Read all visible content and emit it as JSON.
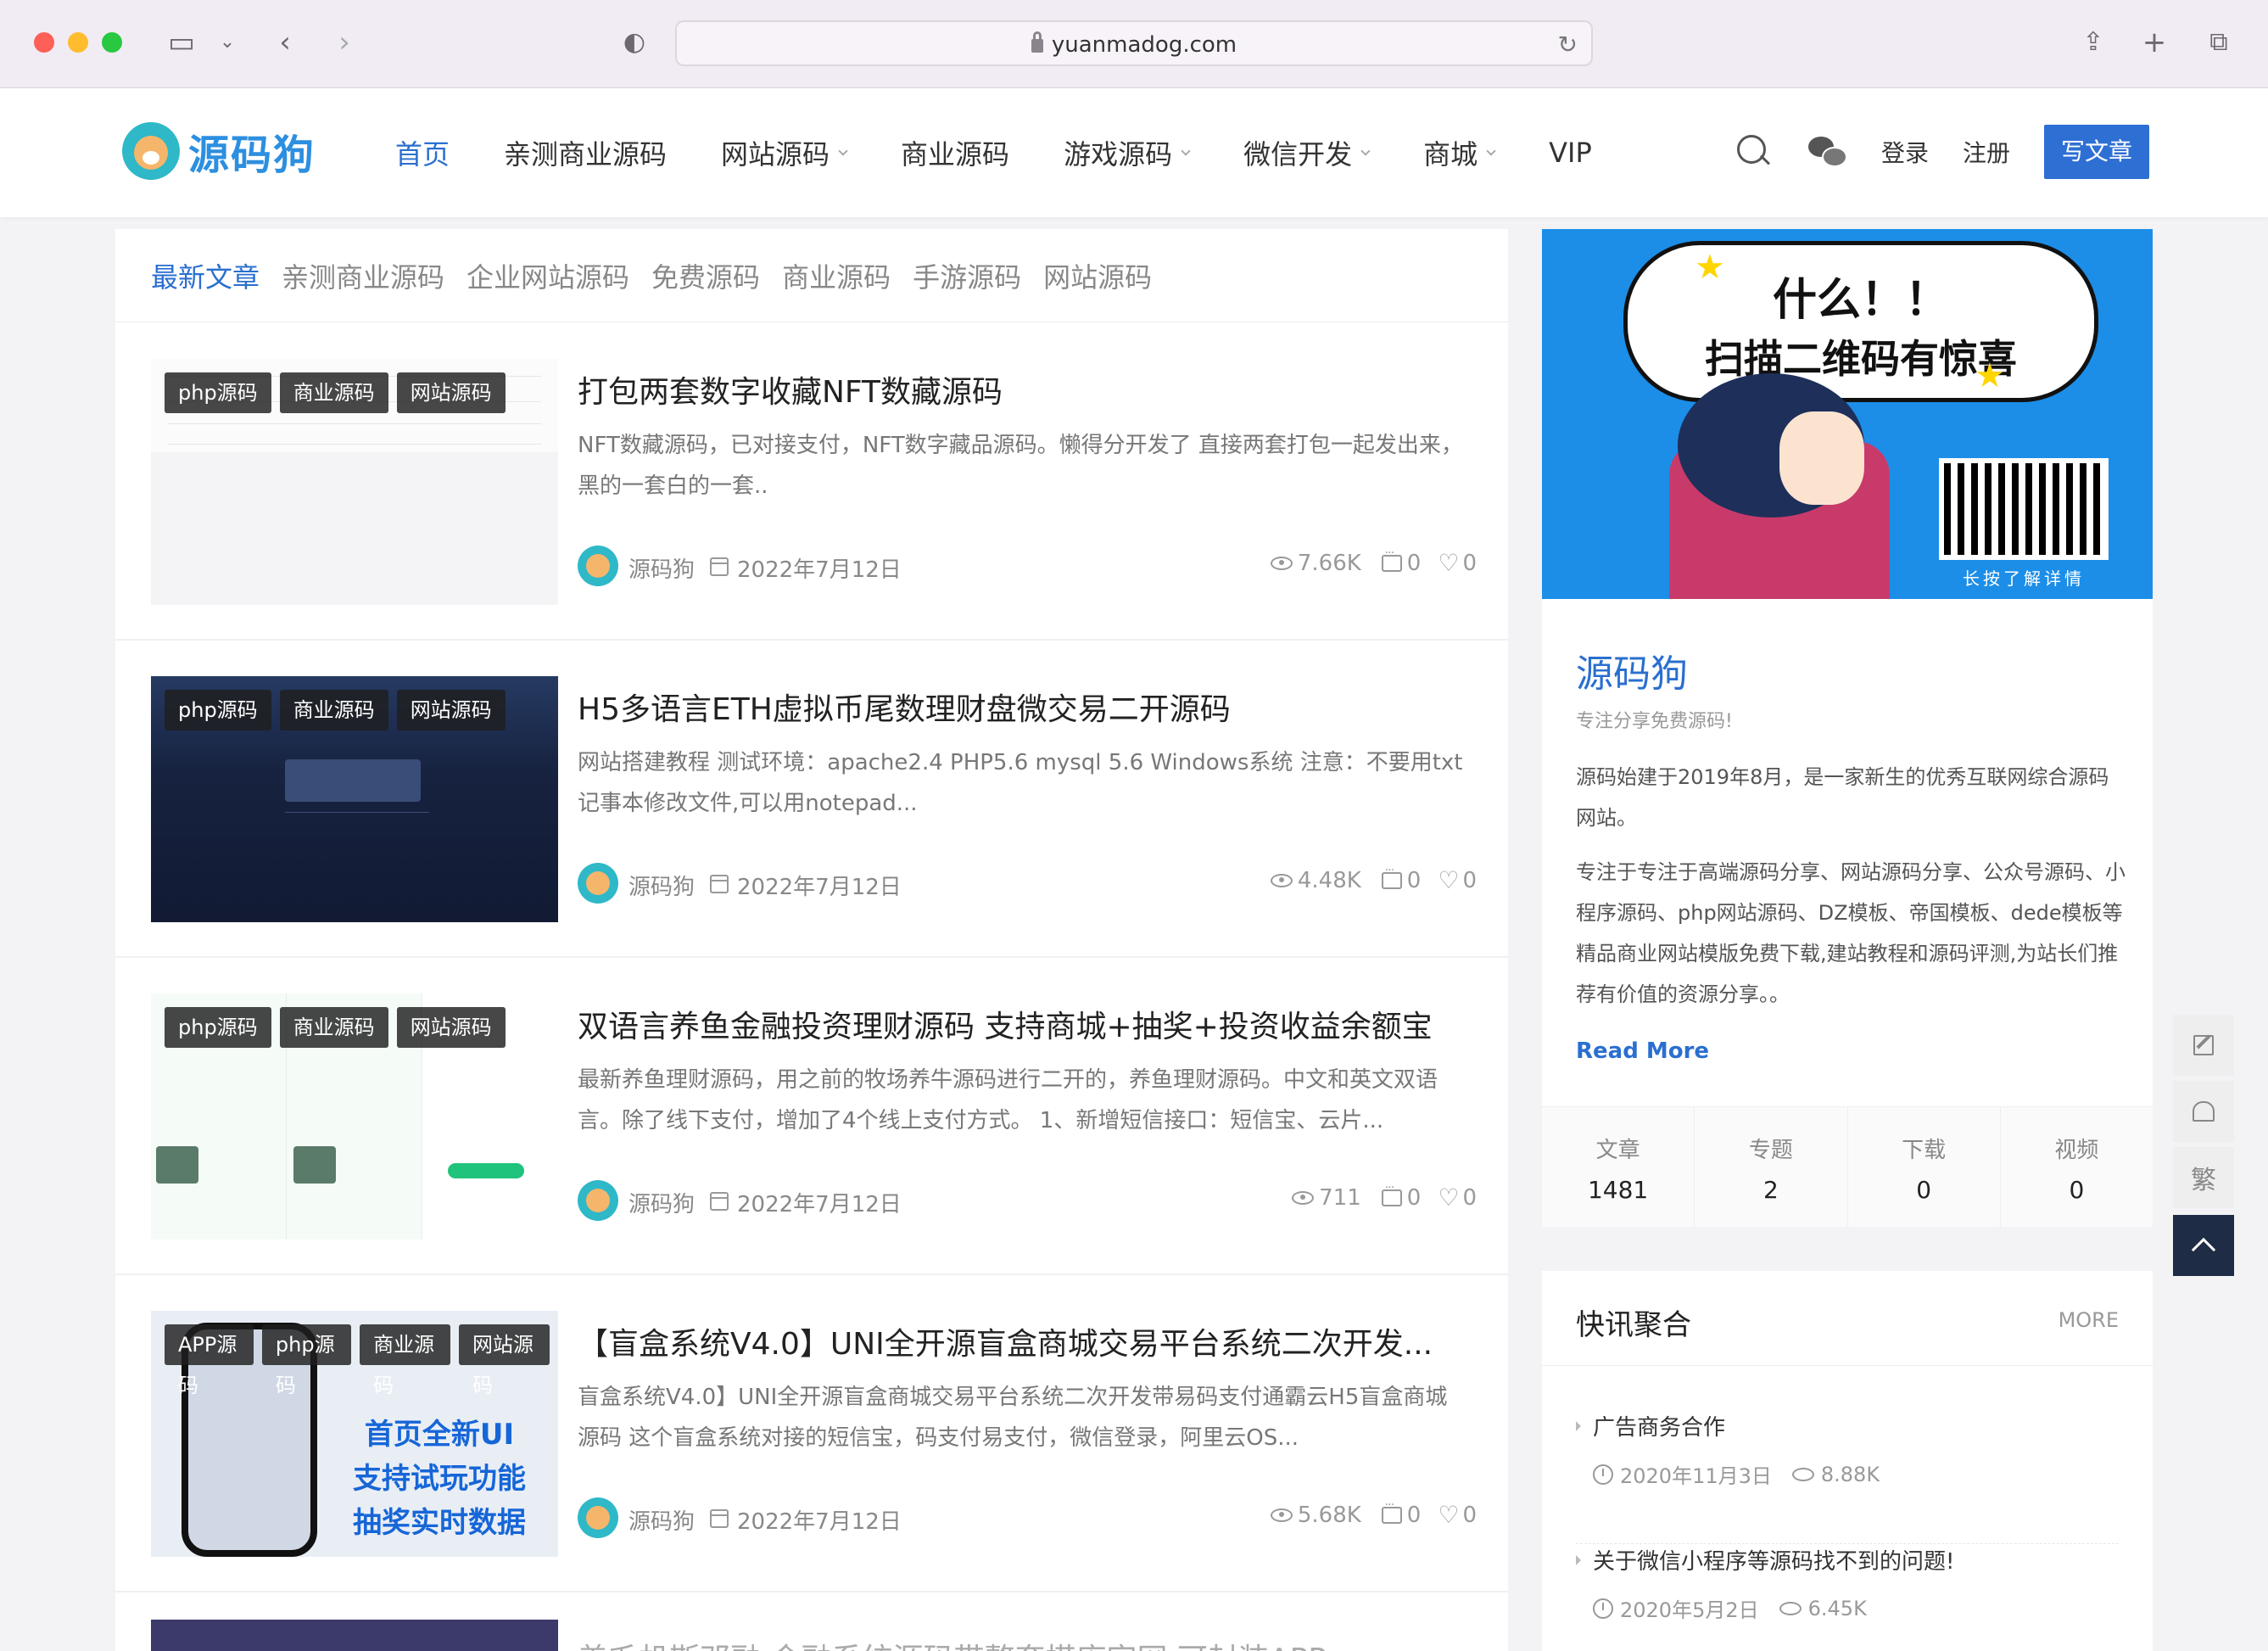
{
  "browser": {
    "url": "yuanmadog.com"
  },
  "site": {
    "logo_text": "源码狗",
    "nav": [
      {
        "label": "首页",
        "active": true,
        "dropdown": false
      },
      {
        "label": "亲测商业源码",
        "active": false,
        "dropdown": false
      },
      {
        "label": "网站源码",
        "active": false,
        "dropdown": true
      },
      {
        "label": "商业源码",
        "active": false,
        "dropdown": false
      },
      {
        "label": "游戏源码",
        "active": false,
        "dropdown": true
      },
      {
        "label": "微信开发",
        "active": false,
        "dropdown": true
      },
      {
        "label": "商城",
        "active": false,
        "dropdown": true
      },
      {
        "label": "VIP",
        "active": false,
        "dropdown": false
      }
    ],
    "login": "登录",
    "register": "注册",
    "write": "写文章",
    "accent_color": "#2e6fd4"
  },
  "tabs": [
    "最新文章",
    "亲测商业源码",
    "企业网站源码",
    "免费源码",
    "商业源码",
    "手游源码",
    "网站源码"
  ],
  "posts": [
    {
      "badges": [
        "php源码",
        "商业源码",
        "网站源码"
      ],
      "title": "打包两套数字收藏NFT数藏源码",
      "excerpt": "NFT数藏源码，已对接支付，NFT数字藏品源码。懒得分开发了 直接两套打包一起发出来，黑的一套白的一套..",
      "author": "源码狗",
      "date": "2022年7月12日",
      "views": "7.66K",
      "comments": "0",
      "likes": "0"
    },
    {
      "badges": [
        "php源码",
        "商业源码",
        "网站源码"
      ],
      "title": "H5多语言ETH虚拟币尾数理财盘微交易二开源码",
      "excerpt": "网站搭建教程 测试环境：apache2.4 PHP5.6 mysql 5.6 Windows系统 注意：不要用txt记事本修改文件,可以用notepad...",
      "author": "源码狗",
      "date": "2022年7月12日",
      "views": "4.48K",
      "comments": "0",
      "likes": "0"
    },
    {
      "badges": [
        "php源码",
        "商业源码",
        "网站源码"
      ],
      "title": "双语言养鱼金融投资理财源码 支持商城+抽奖+投资收益余额宝",
      "excerpt": "最新养鱼理财源码，用之前的牧场养牛源码进行二开的，养鱼理财源码。中文和英文双语言。除了线下支付，增加了4个线上支付方式。 1、新增短信接口：短信宝、云片...",
      "author": "源码狗",
      "date": "2022年7月12日",
      "views": "711",
      "comments": "0",
      "likes": "0"
    },
    {
      "badges": [
        "APP源码",
        "php源码",
        "商业源码",
        "网站源码"
      ],
      "title": "【盲盒系统V4.0】UNI全开源盲盒商城交易平台系统二次开发...",
      "excerpt": "盲盒系统V4.0】UNI全开源盲盒商城交易平台系统二次开发带易码支付通霸云H5盲盒商城源码 这个盲盒系统对接的短信宝，码支付易支付，微信登录，阿里云OS...",
      "author": "源码狗",
      "date": "2022年7月12日",
      "views": "5.68K",
      "comments": "0",
      "likes": "0",
      "thumb_text": [
        "首页全新UI",
        "支持试玩功能",
        "抽奖实时数据"
      ]
    },
    {
      "badges": [],
      "title": "盖毛机斯邓融 金融系统源码带整套搭库字网 可封装APP",
      "excerpt": "",
      "author": "",
      "date": "",
      "views": "",
      "comments": "",
      "likes": ""
    }
  ],
  "sidebar": {
    "banner": {
      "line1": "什么！！",
      "line2": "扫描二维码有惊喜",
      "caption": "长按了解详情"
    },
    "about": {
      "title": "源码狗",
      "subtitle": "专注分享免费源码!",
      "p1": "源码始建于2019年8月，是一家新生的优秀互联网综合源码网站。",
      "p2": "专注于专注于高端源码分享、网站源码分享、公众号源码、小程序源码、php网站源码、DZ模板、帝国模板、dede模板等精品商业网站模版免费下载,建站教程和源码评测,为站长们推荐有价值的资源分享。。",
      "read_more": "Read More",
      "stats": [
        {
          "label": "文章",
          "value": "1481"
        },
        {
          "label": "专题",
          "value": "2"
        },
        {
          "label": "下载",
          "value": "0"
        },
        {
          "label": "视频",
          "value": "0"
        }
      ]
    },
    "news": {
      "title": "快讯聚合",
      "more": "MORE",
      "items": [
        {
          "title": "广告商务合作",
          "date": "2020年11月3日",
          "views": "8.88K"
        },
        {
          "title": "关于微信小程序等源码找不到的问题!",
          "date": "2020年5月2日",
          "views": "6.45K"
        }
      ]
    }
  },
  "float_toolbar": {
    "traditional": "繁"
  }
}
